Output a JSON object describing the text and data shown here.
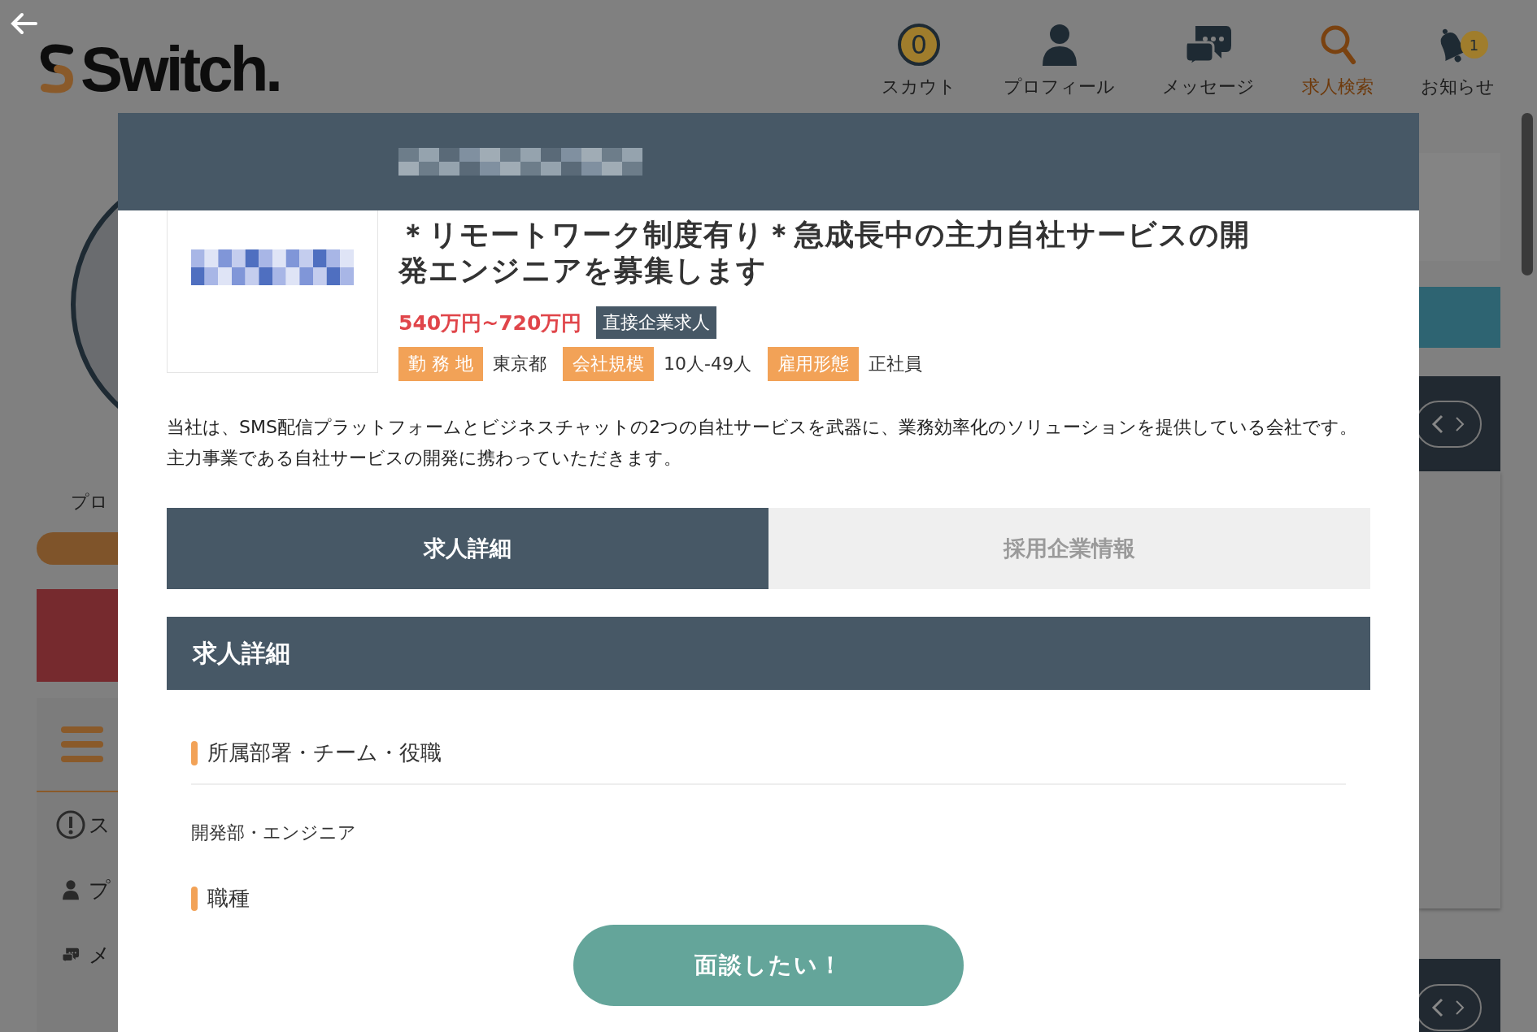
{
  "header": {
    "logo": "Switch.",
    "nav": [
      {
        "label": "スカウト",
        "kind": "coin",
        "badge": "0",
        "selected": false
      },
      {
        "label": "プロフィール",
        "kind": "person",
        "selected": false
      },
      {
        "label": "メッセージ",
        "kind": "chat",
        "selected": false
      },
      {
        "label": "求人検索",
        "kind": "search",
        "selected": true
      },
      {
        "label": "お知らせ",
        "kind": "bell",
        "badge": "1",
        "selected": false
      }
    ]
  },
  "background": {
    "profile_label": "プロ",
    "menu_items": [
      {
        "kind": "alert",
        "label": "ス"
      },
      {
        "kind": "person",
        "label": "プ"
      },
      {
        "kind": "chat",
        "label": "メ"
      }
    ]
  },
  "modal": {
    "title": "＊リモートワーク制度有り＊急成長中の主力自社サービスの開発エンジニアを募集します",
    "salary": "540万円~720万円",
    "badge": "直接企業求人",
    "tags": [
      {
        "label": "勤 務 地",
        "value": "東京都"
      },
      {
        "label": "会社規模",
        "value": "10人-49人"
      },
      {
        "label": "雇用形態",
        "value": "正社員"
      }
    ],
    "description": "当社は、SMS配信プラットフォームとビジネスチャットの2つの自社サービスを武器に、業務効率化のソリューションを提供している会社です。主力事業である自社サービスの開発に携わっていただきます。",
    "tabs": [
      {
        "label": "求人詳細",
        "selected": true
      },
      {
        "label": "採用企業情報",
        "selected": false
      }
    ],
    "section_title": "求人詳細",
    "fields": [
      {
        "heading": "所属部署・チーム・役職",
        "value": "開発部・エンジニア"
      },
      {
        "heading": "職種"
      }
    ],
    "action_button": "面談したい！"
  }
}
